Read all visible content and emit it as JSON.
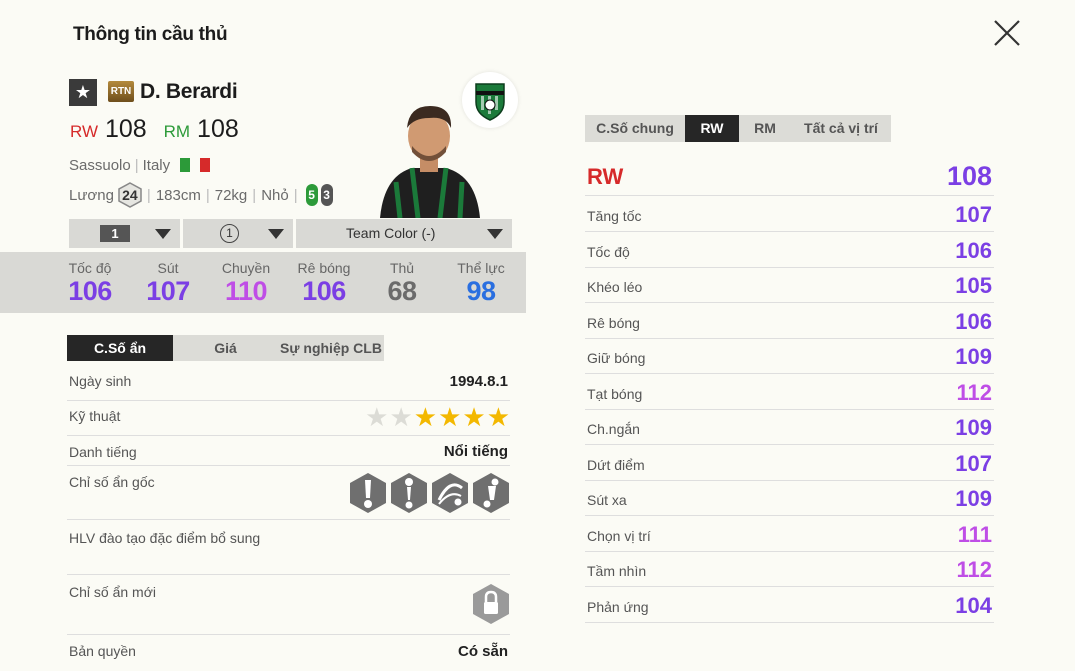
{
  "page": {
    "title": "Thông tin cầu thủ"
  },
  "player": {
    "season_badge": "RTN",
    "name": "D. Berardi",
    "positions": [
      {
        "pos": "RW",
        "ovr": "108",
        "color": "#d62a2a"
      },
      {
        "pos": "RM",
        "ovr": "108",
        "color": "#2c9a39"
      }
    ],
    "club": "Sassuolo",
    "nation": "Italy",
    "salary_label": "Lương",
    "salary": "24",
    "height": "183cm",
    "weight": "72kg",
    "body_type": "Nhỏ",
    "weak_foot_left": "5",
    "weak_foot_right": "3"
  },
  "dropdowns": {
    "level": "1",
    "enhance": "1",
    "team_color": "Team Color (-)"
  },
  "main_stats": [
    {
      "label": "Tốc độ",
      "value": "106",
      "color": "#7b3fe4"
    },
    {
      "label": "Sút",
      "value": "107",
      "color": "#7b3fe4"
    },
    {
      "label": "Chuyền",
      "value": "110",
      "color": "#bf4ee6"
    },
    {
      "label": "Rê bóng",
      "value": "106",
      "color": "#7b3fe4"
    },
    {
      "label": "Thủ",
      "value": "68",
      "color": "#6b6b6b"
    },
    {
      "label": "Thể lực",
      "value": "98",
      "color": "#2a6fe0"
    }
  ],
  "left_tabs": [
    {
      "label": "C.Số ẩn",
      "active": true
    },
    {
      "label": "Giá",
      "active": false
    },
    {
      "label": "Sự nghiệp CLB",
      "active": false
    }
  ],
  "details": {
    "dob_label": "Ngày sinh",
    "dob": "1994.8.1",
    "skill_label": "Kỹ thuật",
    "skill_stars": 4,
    "skill_max": 6,
    "fame_label": "Danh tiếng",
    "fame": "Nổi tiếng",
    "traits_label": "Chỉ số ẩn gốc",
    "trait_icons": [
      "finesse-shot-trait-icon",
      "power-header-trait-icon",
      "long-passer-trait-icon",
      "flair-trait-icon"
    ],
    "coach_label": "HLV đào tạo đặc điểm bổ sung",
    "new_traits_label": "Chỉ số ẩn mới",
    "license_label": "Bản quyền",
    "license": "Có sẵn"
  },
  "right_tabs": [
    {
      "label": "C.Số chung",
      "active": false
    },
    {
      "label": "RW",
      "active": true
    },
    {
      "label": "RM",
      "active": false
    },
    {
      "label": "Tất cả vị trí",
      "active": false
    }
  ],
  "position_stats": {
    "position": "RW",
    "ovr": "108",
    "ovr_color": "#7b3fe4",
    "rows": [
      {
        "label": "Tăng tốc",
        "value": "107",
        "color": "#7b3fe4"
      },
      {
        "label": "Tốc độ",
        "value": "106",
        "color": "#7b3fe4"
      },
      {
        "label": "Khéo léo",
        "value": "105",
        "color": "#7b3fe4"
      },
      {
        "label": "Rê bóng",
        "value": "106",
        "color": "#7b3fe4"
      },
      {
        "label": "Giữ bóng",
        "value": "109",
        "color": "#7b3fe4"
      },
      {
        "label": "Tạt bóng",
        "value": "112",
        "color": "#bf4ee6"
      },
      {
        "label": "Ch.ngắn",
        "value": "109",
        "color": "#7b3fe4"
      },
      {
        "label": "Dứt điểm",
        "value": "107",
        "color": "#7b3fe4"
      },
      {
        "label": "Sút xa",
        "value": "109",
        "color": "#7b3fe4"
      },
      {
        "label": "Chọn vị trí",
        "value": "111",
        "color": "#bf4ee6"
      },
      {
        "label": "Tầm nhìn",
        "value": "112",
        "color": "#bf4ee6"
      },
      {
        "label": "Phản ứng",
        "value": "104",
        "color": "#7b3fe4"
      }
    ]
  },
  "colors": {
    "background": "#fbfbf5",
    "accent_red": "#d62a2a",
    "accent_green": "#2c9a39",
    "purple": "#7b3fe4",
    "violet": "#bf4ee6",
    "blue": "#2a6fe0",
    "star_gold": "#f3b800"
  }
}
